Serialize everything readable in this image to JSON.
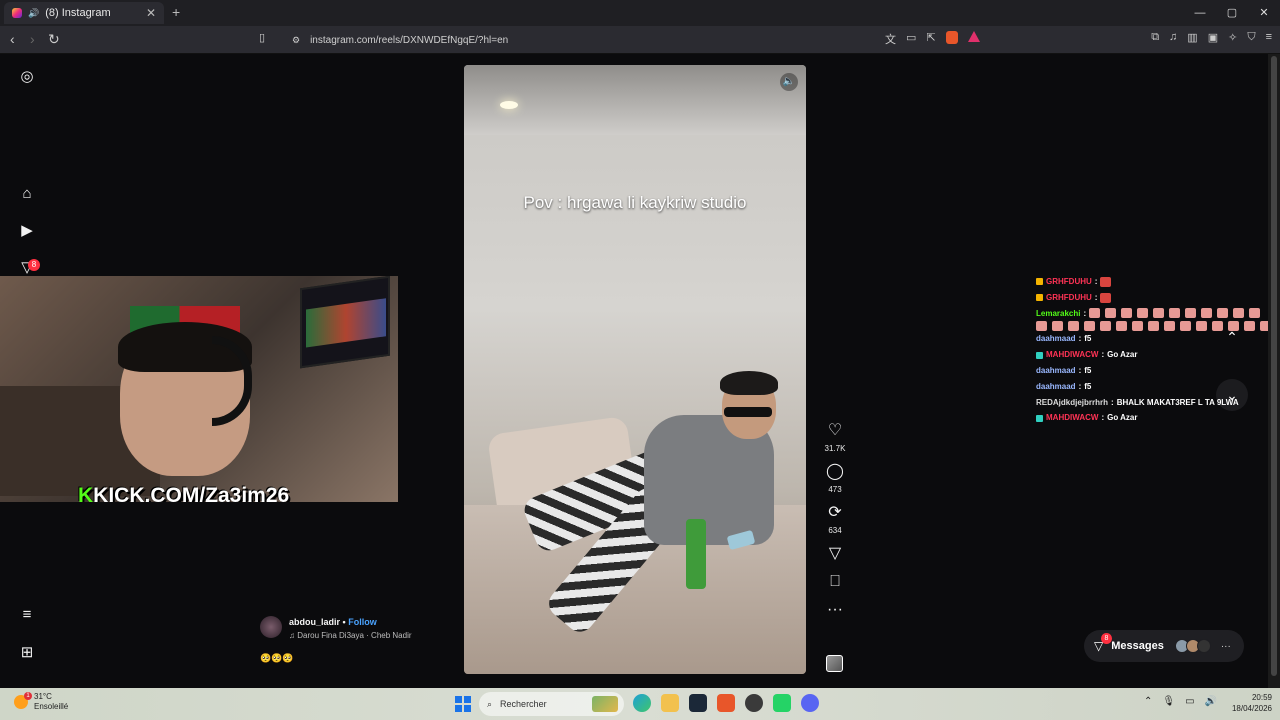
{
  "browser": {
    "tab_title": "(8) Instagram",
    "tab_close": "✕",
    "new_tab": "+",
    "window_controls": [
      "—",
      "▢",
      "✕"
    ],
    "url": "instagram.com/reels/DXNWDEfNgqE/?hl=en"
  },
  "sidebar": {
    "notifications_count": "8",
    "icons": [
      "instagram-logo-icon",
      "home-icon",
      "reels-icon",
      "direct-icon",
      "menu-icon",
      "apps-icon"
    ]
  },
  "reel": {
    "caption": "Pov : hrgawa li kaykriw studio",
    "likes": "31.7K",
    "comments": "473",
    "reposts": "634",
    "author": "abdou_ladir",
    "follow_label": "Follow",
    "song": "Darou Fina Di3aya · Cheb Nadir",
    "emojis": "🥺🥺🥺",
    "separator": "•"
  },
  "webcam": {
    "brand_k": "K",
    "brand_text": "KICK.COM/Za3im26"
  },
  "chat": {
    "messages": [
      {
        "user": "GRHFDUHU",
        "text": "",
        "color": "#ff3355",
        "badge": "#f5b400",
        "emote": true
      },
      {
        "user": "GRHFDUHU",
        "text": "",
        "color": "#ff3355",
        "badge": "#f5b400",
        "emote": true
      },
      {
        "user": "Lemarakchi",
        "text": "",
        "color": "#53fc18",
        "badge": "",
        "emote_row": true
      },
      {
        "user": "daahmaad",
        "text": "f5",
        "color": "#9ab8ff",
        "badge": ""
      },
      {
        "user": "MAHDIWACW",
        "text": "Go Azar",
        "color": "#ff3355",
        "badge": "#30d0c0"
      },
      {
        "user": "daahmaad",
        "text": "f5",
        "color": "#9ab8ff",
        "badge": ""
      },
      {
        "user": "daahmaad",
        "text": "f5",
        "color": "#9ab8ff",
        "badge": ""
      },
      {
        "user": "REDAjdkdjejbrrhrh",
        "text": "BHALK MAKAT3REF L TA 9LWA",
        "color": "#dcdcdc",
        "badge": ""
      },
      {
        "user": "MAHDIWACW",
        "text": "Go Azar",
        "color": "#ff3355",
        "badge": "#30d0c0"
      }
    ]
  },
  "messages_pill": {
    "label": "Messages",
    "count": "8"
  },
  "taskbar": {
    "temperature": "31°C",
    "weather": "Ensoleillé",
    "search_placeholder": "Rechercher",
    "time": "20:59",
    "date": "18/04/2026",
    "weather_badge": "1"
  }
}
